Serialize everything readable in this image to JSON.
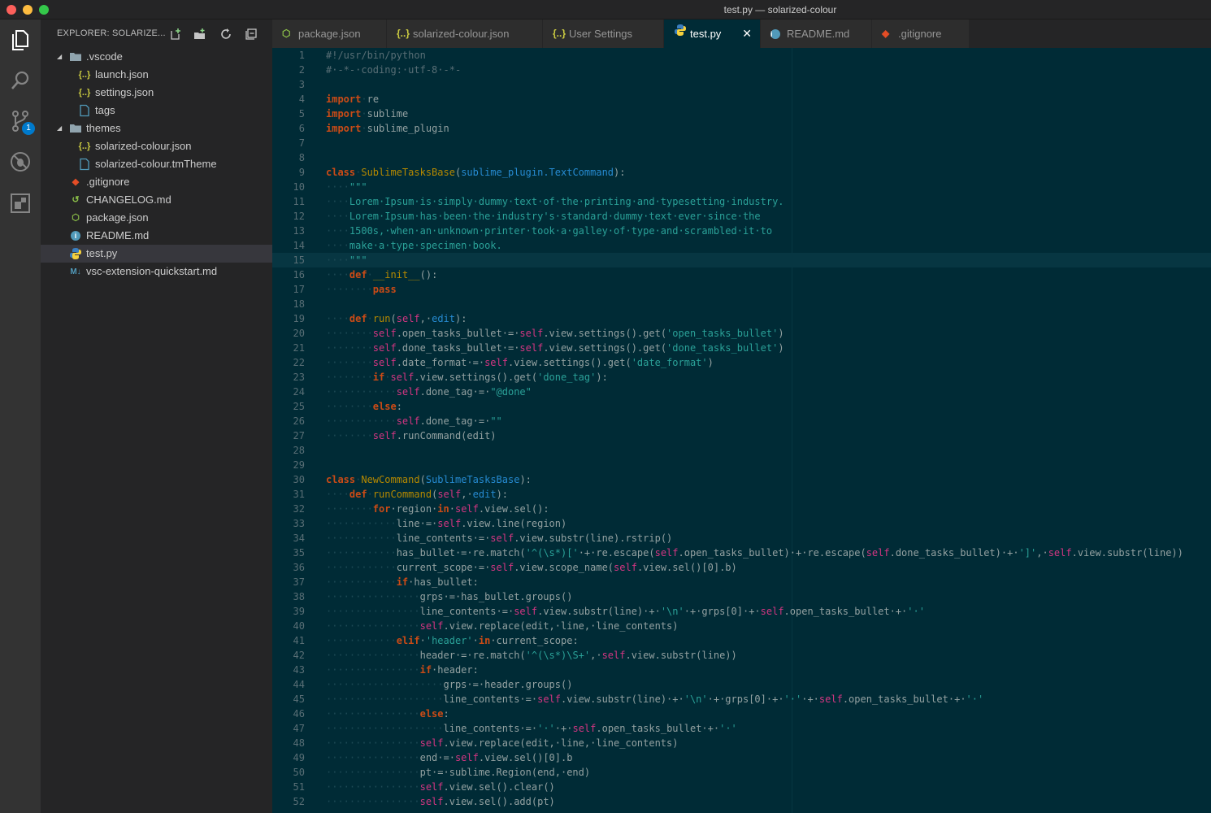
{
  "window": {
    "title": "test.py — solarized-colour"
  },
  "activity_bar": {
    "items": [
      {
        "name": "explorer-icon"
      },
      {
        "name": "search-icon"
      },
      {
        "name": "source-control-icon",
        "badge": "1"
      },
      {
        "name": "debug-icon"
      },
      {
        "name": "extensions-icon"
      }
    ]
  },
  "explorer": {
    "title": "EXPLORER: SOLARIZE...",
    "tree": [
      {
        "label": ".vscode",
        "type": "folder",
        "depth": 0,
        "expanded": true
      },
      {
        "label": "launch.json",
        "type": "json",
        "depth": 1
      },
      {
        "label": "settings.json",
        "type": "json",
        "depth": 1
      },
      {
        "label": "tags",
        "type": "file",
        "depth": 1
      },
      {
        "label": "themes",
        "type": "folder",
        "depth": 0,
        "expanded": true
      },
      {
        "label": "solarized-colour.json",
        "type": "json",
        "depth": 1
      },
      {
        "label": "solarized-colour.tmTheme",
        "type": "file",
        "depth": 1
      },
      {
        "label": ".gitignore",
        "type": "git",
        "depth": 0
      },
      {
        "label": "CHANGELOG.md",
        "type": "changelog",
        "depth": 0
      },
      {
        "label": "package.json",
        "type": "npm",
        "depth": 0
      },
      {
        "label": "README.md",
        "type": "info",
        "depth": 0
      },
      {
        "label": "test.py",
        "type": "python",
        "depth": 0,
        "selected": true
      },
      {
        "label": "vsc-extension-quickstart.md",
        "type": "markdown",
        "depth": 0
      }
    ]
  },
  "tabs": [
    {
      "label": "package.json",
      "icon": "npm"
    },
    {
      "label": "solarized-colour.json",
      "icon": "json"
    },
    {
      "label": "User Settings",
      "icon": "json"
    },
    {
      "label": "test.py",
      "icon": "python",
      "active": true
    },
    {
      "label": "README.md",
      "icon": "info"
    },
    {
      "label": ".gitignore",
      "icon": "git"
    }
  ],
  "colors": {
    "editor_bg": "#002b36",
    "keyword": "#cb4b16",
    "string": "#2aa198",
    "function": "#b58900",
    "self": "#d33682",
    "builtin": "#268bd2",
    "comment": "#586e75",
    "text": "#93a1a1"
  },
  "editor": {
    "current_line": 15,
    "lines": [
      [
        [
          "c",
          "#!/usr/bin/python"
        ]
      ],
      [
        [
          "c",
          "#·-*-·coding:·utf-8·-*-"
        ]
      ],
      [],
      [
        [
          "k",
          "import"
        ],
        [
          "ws",
          "·"
        ],
        [
          "t",
          "re"
        ]
      ],
      [
        [
          "k",
          "import"
        ],
        [
          "ws",
          "·"
        ],
        [
          "t",
          "sublime"
        ]
      ],
      [
        [
          "k",
          "import"
        ],
        [
          "ws",
          "·"
        ],
        [
          "t",
          "sublime_plugin"
        ]
      ],
      [],
      [],
      [
        [
          "k",
          "class"
        ],
        [
          "ws",
          "·"
        ],
        [
          "f",
          "SublimeTasksBase"
        ],
        [
          "t",
          "("
        ],
        [
          "b",
          "sublime_plugin.TextCommand"
        ],
        [
          "t",
          "):"
        ]
      ],
      [
        [
          "ws",
          "····"
        ],
        [
          "s",
          "\"\"\""
        ]
      ],
      [
        [
          "ws",
          "····"
        ],
        [
          "s",
          "Lorem·Ipsum·is·simply·dummy·text·of·the·printing·and·typesetting·industry."
        ]
      ],
      [
        [
          "ws",
          "····"
        ],
        [
          "s",
          "Lorem·Ipsum·has·been·the·industry's·standard·dummy·text·ever·since·the"
        ]
      ],
      [
        [
          "ws",
          "····"
        ],
        [
          "s",
          "1500s,·when·an·unknown·printer·took·a·galley·of·type·and·scrambled·it·to"
        ]
      ],
      [
        [
          "ws",
          "····"
        ],
        [
          "s",
          "make·a·type·specimen·book."
        ]
      ],
      [
        [
          "ws",
          "····"
        ],
        [
          "s",
          "\"\"\""
        ]
      ],
      [
        [
          "ws",
          "····"
        ],
        [
          "k",
          "def"
        ],
        [
          "ws",
          "·"
        ],
        [
          "f",
          "__init__"
        ],
        [
          "t",
          "():"
        ]
      ],
      [
        [
          "ws",
          "········"
        ],
        [
          "k",
          "pass"
        ]
      ],
      [],
      [
        [
          "ws",
          "····"
        ],
        [
          "k",
          "def"
        ],
        [
          "ws",
          "·"
        ],
        [
          "f",
          "run"
        ],
        [
          "t",
          "("
        ],
        [
          "sf",
          "self"
        ],
        [
          "t",
          ",·"
        ],
        [
          "b",
          "edit"
        ],
        [
          "t",
          "):"
        ]
      ],
      [
        [
          "ws",
          "········"
        ],
        [
          "sf",
          "self"
        ],
        [
          "t",
          ".open_tasks_bullet·=·"
        ],
        [
          "sf",
          "self"
        ],
        [
          "t",
          ".view.settings().get("
        ],
        [
          "s",
          "'open_tasks_bullet'"
        ],
        [
          "t",
          ")"
        ]
      ],
      [
        [
          "ws",
          "········"
        ],
        [
          "sf",
          "self"
        ],
        [
          "t",
          ".done_tasks_bullet·=·"
        ],
        [
          "sf",
          "self"
        ],
        [
          "t",
          ".view.settings().get("
        ],
        [
          "s",
          "'done_tasks_bullet'"
        ],
        [
          "t",
          ")"
        ]
      ],
      [
        [
          "ws",
          "········"
        ],
        [
          "sf",
          "self"
        ],
        [
          "t",
          ".date_format·=·"
        ],
        [
          "sf",
          "self"
        ],
        [
          "t",
          ".view.settings().get("
        ],
        [
          "s",
          "'date_format'"
        ],
        [
          "t",
          ")"
        ]
      ],
      [
        [
          "ws",
          "········"
        ],
        [
          "k",
          "if"
        ],
        [
          "ws",
          "·"
        ],
        [
          "sf",
          "self"
        ],
        [
          "t",
          ".view.settings().get("
        ],
        [
          "s",
          "'done_tag'"
        ],
        [
          "t",
          "):"
        ]
      ],
      [
        [
          "ws",
          "············"
        ],
        [
          "sf",
          "self"
        ],
        [
          "t",
          ".done_tag·=·"
        ],
        [
          "s",
          "\"@done\""
        ]
      ],
      [
        [
          "ws",
          "········"
        ],
        [
          "k",
          "else"
        ],
        [
          "t",
          ":"
        ]
      ],
      [
        [
          "ws",
          "············"
        ],
        [
          "sf",
          "self"
        ],
        [
          "t",
          ".done_tag·=·"
        ],
        [
          "s",
          "\"\""
        ]
      ],
      [
        [
          "ws",
          "········"
        ],
        [
          "sf",
          "self"
        ],
        [
          "t",
          ".runCommand(edit)"
        ]
      ],
      [],
      [],
      [
        [
          "k",
          "class"
        ],
        [
          "ws",
          "·"
        ],
        [
          "f",
          "NewCommand"
        ],
        [
          "t",
          "("
        ],
        [
          "b",
          "SublimeTasksBase"
        ],
        [
          "t",
          "):"
        ]
      ],
      [
        [
          "ws",
          "····"
        ],
        [
          "k",
          "def"
        ],
        [
          "ws",
          "·"
        ],
        [
          "f",
          "runCommand"
        ],
        [
          "t",
          "("
        ],
        [
          "sf",
          "self"
        ],
        [
          "t",
          ",·"
        ],
        [
          "b",
          "edit"
        ],
        [
          "t",
          "):"
        ]
      ],
      [
        [
          "ws",
          "········"
        ],
        [
          "k",
          "for"
        ],
        [
          "t",
          "·region·"
        ],
        [
          "k",
          "in"
        ],
        [
          "t",
          "·"
        ],
        [
          "sf",
          "self"
        ],
        [
          "t",
          ".view.sel():"
        ]
      ],
      [
        [
          "ws",
          "············"
        ],
        [
          "t",
          "line·=·"
        ],
        [
          "sf",
          "self"
        ],
        [
          "t",
          ".view.line(region)"
        ]
      ],
      [
        [
          "ws",
          "············"
        ],
        [
          "t",
          "line_contents·=·"
        ],
        [
          "sf",
          "self"
        ],
        [
          "t",
          ".view.substr(line).rstrip()"
        ]
      ],
      [
        [
          "ws",
          "············"
        ],
        [
          "t",
          "has_bullet·=·re.match("
        ],
        [
          "s",
          "'^(\\s*)['"
        ],
        [
          "t",
          "·+·re.escape("
        ],
        [
          "sf",
          "self"
        ],
        [
          "t",
          ".open_tasks_bullet)·+·re.escape("
        ],
        [
          "sf",
          "self"
        ],
        [
          "t",
          ".done_tasks_bullet)·+·"
        ],
        [
          "s",
          "']'"
        ],
        [
          "t",
          ",·"
        ],
        [
          "sf",
          "self"
        ],
        [
          "t",
          ".view.substr(line))"
        ]
      ],
      [
        [
          "ws",
          "············"
        ],
        [
          "t",
          "current_scope·=·"
        ],
        [
          "sf",
          "self"
        ],
        [
          "t",
          ".view.scope_name("
        ],
        [
          "sf",
          "self"
        ],
        [
          "t",
          ".view.sel()[0].b)"
        ]
      ],
      [
        [
          "ws",
          "············"
        ],
        [
          "k",
          "if"
        ],
        [
          "t",
          "·has_bullet:"
        ]
      ],
      [
        [
          "ws",
          "················"
        ],
        [
          "t",
          "grps·=·has_bullet.groups()"
        ]
      ],
      [
        [
          "ws",
          "················"
        ],
        [
          "t",
          "line_contents·=·"
        ],
        [
          "sf",
          "self"
        ],
        [
          "t",
          ".view.substr(line)·+·"
        ],
        [
          "s",
          "'\\n'"
        ],
        [
          "t",
          "·+·grps[0]·+·"
        ],
        [
          "sf",
          "self"
        ],
        [
          "t",
          ".open_tasks_bullet·+·"
        ],
        [
          "s",
          "'·'"
        ]
      ],
      [
        [
          "ws",
          "················"
        ],
        [
          "sf",
          "self"
        ],
        [
          "t",
          ".view.replace(edit,·line,·line_contents)"
        ]
      ],
      [
        [
          "ws",
          "············"
        ],
        [
          "k",
          "elif"
        ],
        [
          "t",
          "·"
        ],
        [
          "s",
          "'header'"
        ],
        [
          "t",
          "·"
        ],
        [
          "k",
          "in"
        ],
        [
          "t",
          "·current_scope:"
        ]
      ],
      [
        [
          "ws",
          "················"
        ],
        [
          "t",
          "header·=·re.match("
        ],
        [
          "s",
          "'^(\\s*)\\S+'"
        ],
        [
          "t",
          ",·"
        ],
        [
          "sf",
          "self"
        ],
        [
          "t",
          ".view.substr(line))"
        ]
      ],
      [
        [
          "ws",
          "················"
        ],
        [
          "k",
          "if"
        ],
        [
          "t",
          "·header:"
        ]
      ],
      [
        [
          "ws",
          "····················"
        ],
        [
          "t",
          "grps·=·header.groups()"
        ]
      ],
      [
        [
          "ws",
          "····················"
        ],
        [
          "t",
          "line_contents·=·"
        ],
        [
          "sf",
          "self"
        ],
        [
          "t",
          ".view.substr(line)·+·"
        ],
        [
          "s",
          "'\\n'"
        ],
        [
          "t",
          "·+·grps[0]·+·"
        ],
        [
          "s",
          "'·'"
        ],
        [
          "t",
          "·+·"
        ],
        [
          "sf",
          "self"
        ],
        [
          "t",
          ".open_tasks_bullet·+·"
        ],
        [
          "s",
          "'·'"
        ]
      ],
      [
        [
          "ws",
          "················"
        ],
        [
          "k",
          "else"
        ],
        [
          "t",
          ":"
        ]
      ],
      [
        [
          "ws",
          "····················"
        ],
        [
          "t",
          "line_contents·=·"
        ],
        [
          "s",
          "'·'"
        ],
        [
          "t",
          "·+·"
        ],
        [
          "sf",
          "self"
        ],
        [
          "t",
          ".open_tasks_bullet·+·"
        ],
        [
          "s",
          "'·'"
        ]
      ],
      [
        [
          "ws",
          "················"
        ],
        [
          "sf",
          "self"
        ],
        [
          "t",
          ".view.replace(edit,·line,·line_contents)"
        ]
      ],
      [
        [
          "ws",
          "················"
        ],
        [
          "t",
          "end·=·"
        ],
        [
          "sf",
          "self"
        ],
        [
          "t",
          ".view.sel()[0].b"
        ]
      ],
      [
        [
          "ws",
          "················"
        ],
        [
          "t",
          "pt·=·sublime.Region(end,·end)"
        ]
      ],
      [
        [
          "ws",
          "················"
        ],
        [
          "sf",
          "self"
        ],
        [
          "t",
          ".view.sel().clear()"
        ]
      ],
      [
        [
          "ws",
          "················"
        ],
        [
          "sf",
          "self"
        ],
        [
          "t",
          ".view.sel().add(pt)"
        ]
      ]
    ]
  }
}
